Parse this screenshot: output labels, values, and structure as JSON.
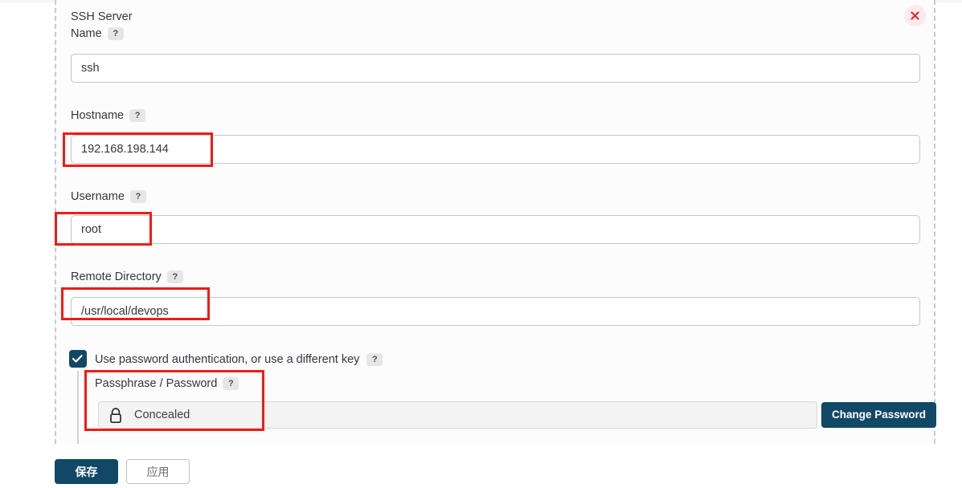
{
  "window": {
    "close_icon": "close-icon"
  },
  "form": {
    "fields": [
      {
        "label": "SSH Server Name",
        "label_line1": "SSH Server",
        "label_line2": "Name",
        "help": "?",
        "value": "ssh",
        "placeholder": ""
      },
      {
        "label": "Hostname",
        "help": "?",
        "value": "192.168.198.144",
        "placeholder": ""
      },
      {
        "label": "Username",
        "help": "?",
        "value": "root",
        "placeholder": ""
      },
      {
        "label": "Remote Directory",
        "help": "?",
        "value": "/usr/local/devops",
        "placeholder": ""
      }
    ],
    "checkbox": {
      "label": "Use password authentication, or use a different key",
      "help": "?",
      "checked": true
    },
    "password_section": {
      "label": "Passphrase / Password",
      "help": "?",
      "value": "Concealed",
      "lock_icon": "lock-icon",
      "change_button": "Change Password"
    }
  },
  "footer": {
    "save_label": "保存",
    "apply_label": "应用"
  },
  "colors": {
    "accent": "#114866",
    "annotation": "#ed1c16",
    "close_bg": "#fdeaec",
    "close_fg": "#e0293a",
    "input_border": "#c0c8cf",
    "panel_dash": "#c2ccd6"
  }
}
